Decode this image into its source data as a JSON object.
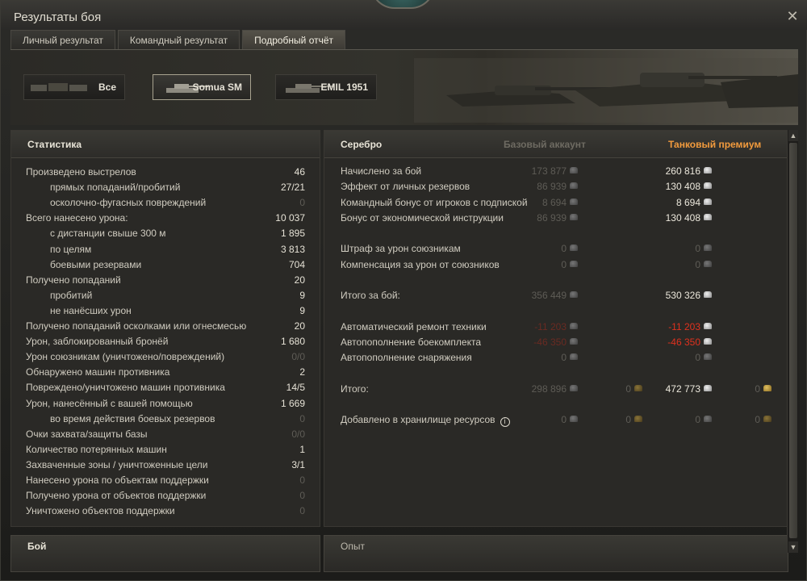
{
  "window": {
    "title": "Результаты боя"
  },
  "tabs": [
    {
      "label": "Личный результат"
    },
    {
      "label": "Командный результат"
    },
    {
      "label": "Подробный отчёт",
      "active": true
    }
  ],
  "vehicles": [
    {
      "label": "Все"
    },
    {
      "label": "Somua SM",
      "selected": true
    },
    {
      "label": "EMIL 1951"
    }
  ],
  "stats": {
    "header": "Статистика",
    "rows": [
      {
        "label": "Произведено выстрелов",
        "value": "46"
      },
      {
        "label": "прямых попаданий/пробитий",
        "value": "27/21",
        "indent": true
      },
      {
        "label": "осколочно-фугасных повреждений",
        "value": "0",
        "indent": true,
        "dim": true
      },
      {
        "label": "Всего нанесено урона:",
        "value": "10 037"
      },
      {
        "label": "с дистанции свыше 300 м",
        "value": "1 895",
        "indent": true
      },
      {
        "label": "по целям",
        "value": "3 813",
        "indent": true
      },
      {
        "label": "боевыми резервами",
        "value": "704",
        "indent": true
      },
      {
        "label": "Получено попаданий",
        "value": "20"
      },
      {
        "label": "пробитий",
        "value": "9",
        "indent": true
      },
      {
        "label": "не нанёсших урон",
        "value": "9",
        "indent": true
      },
      {
        "label": "Получено попаданий осколками или огнесмесью",
        "value": "20"
      },
      {
        "label": "Урон, заблокированный бронёй",
        "value": "1 680"
      },
      {
        "label": "Урон союзникам (уничтожено/повреждений)",
        "value": "0/0",
        "dim": true
      },
      {
        "label": "Обнаружено машин противника",
        "value": "2"
      },
      {
        "label": "Повреждено/уничтожено машин противника",
        "value": "14/5"
      },
      {
        "label": "Урон, нанесённый с вашей помощью",
        "value": "1 669"
      },
      {
        "label": "во время действия боевых резервов",
        "value": "0",
        "indent": true,
        "dim": true
      },
      {
        "label": "Очки захвата/защиты базы",
        "value": "0/0",
        "dim": true
      },
      {
        "label": "Количество потерянных машин",
        "value": "1"
      },
      {
        "label": "Захваченные зоны / уничтоженные цели",
        "value": "3/1"
      },
      {
        "label": "Нанесено урона по объектам поддержки",
        "value": "0",
        "dim": true
      },
      {
        "label": "Получено урона от объектов поддержки",
        "value": "0",
        "dim": true
      },
      {
        "label": "Уничтожено объектов поддержки",
        "value": "0",
        "dim": true
      }
    ]
  },
  "credits": {
    "header": "Серебро",
    "col_base": "Базовый аккаунт",
    "col_premium": "Танковый премиум",
    "accent_color": "#f29b3d",
    "rows": [
      {
        "label": "Начислено за бой",
        "base": "173 877",
        "premium": "260 816"
      },
      {
        "label": "Эффект от личных резервов",
        "base": "86 939",
        "premium": "130 408"
      },
      {
        "label": "Командный бонус от игроков с подпиской",
        "base": "8 694",
        "premium": "8 694"
      },
      {
        "label": "Бонус от экономической инструкции",
        "base": "86 939",
        "premium": "130 408"
      },
      {
        "spacer": true
      },
      {
        "label": "Штраф за урон союзникам",
        "base": "0",
        "premium": "0",
        "premium_dim": true
      },
      {
        "label": "Компенсация за урон от союзников",
        "base": "0",
        "premium": "0",
        "premium_dim": true
      },
      {
        "spacer": true
      },
      {
        "label": "Итого за бой:",
        "base": "356 449",
        "premium": "530 326"
      },
      {
        "spacer": true
      },
      {
        "label": "Автоматический ремонт техники",
        "base": "-11 203",
        "premium": "-11 203",
        "negative": true
      },
      {
        "label": "Автопополнение боекомплекта",
        "base": "-46 350",
        "premium": "-46 350",
        "negative": true
      },
      {
        "label": "Автопополнение снаряжения",
        "base": "0",
        "premium": "0",
        "premium_dim": true
      },
      {
        "spacer": true
      },
      {
        "label": "Итого:",
        "base": "298 896",
        "base_gold": "0",
        "premium": "472 773",
        "premium_gold": "0"
      },
      {
        "spacer": true
      },
      {
        "label": "Добавлено в хранилище ресурсов",
        "base": "0",
        "base_gold": "0",
        "premium": "0",
        "premium_gold": "0",
        "premium_dim": true,
        "info": true
      }
    ]
  },
  "bottom": {
    "left_title": "Бой",
    "right_title": "Опыт"
  }
}
